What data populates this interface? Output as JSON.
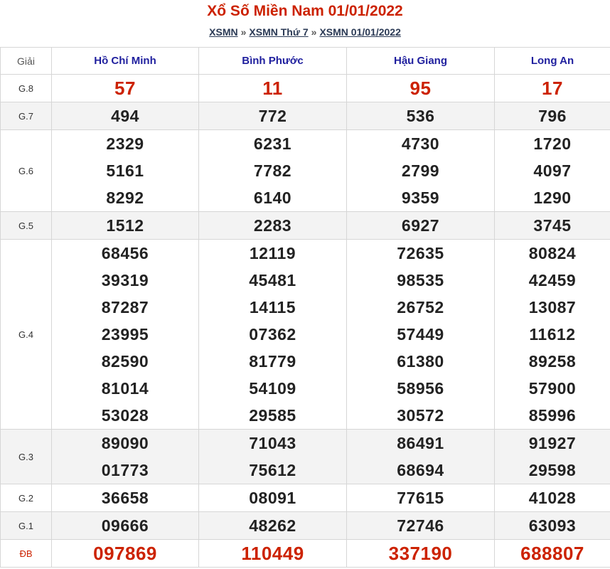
{
  "title": "Xổ Số Miền Nam 01/01/2022",
  "breadcrumb": [
    "XSMN",
    "XSMN Thứ 7",
    "XSMN 01/01/2022"
  ],
  "breadcrumb_sep": "»",
  "table": {
    "label_header": "Giải",
    "provinces": [
      "Hồ Chí Minh",
      "Bình Phước",
      "Hậu Giang",
      "Long An"
    ],
    "rows": [
      {
        "label": "G.8",
        "shade": false,
        "red": true,
        "values": [
          [
            "57"
          ],
          [
            "11"
          ],
          [
            "95"
          ],
          [
            "17"
          ]
        ]
      },
      {
        "label": "G.7",
        "shade": true,
        "red": false,
        "values": [
          [
            "494"
          ],
          [
            "772"
          ],
          [
            "536"
          ],
          [
            "796"
          ]
        ]
      },
      {
        "label": "G.6",
        "shade": false,
        "red": false,
        "values": [
          [
            "2329",
            "5161",
            "8292"
          ],
          [
            "6231",
            "7782",
            "6140"
          ],
          [
            "4730",
            "2799",
            "9359"
          ],
          [
            "1720",
            "4097",
            "1290"
          ]
        ]
      },
      {
        "label": "G.5",
        "shade": true,
        "red": false,
        "values": [
          [
            "1512"
          ],
          [
            "2283"
          ],
          [
            "6927"
          ],
          [
            "3745"
          ]
        ]
      },
      {
        "label": "G.4",
        "shade": false,
        "red": false,
        "values": [
          [
            "68456",
            "39319",
            "87287",
            "23995",
            "82590",
            "81014",
            "53028"
          ],
          [
            "12119",
            "45481",
            "14115",
            "07362",
            "81779",
            "54109",
            "29585"
          ],
          [
            "72635",
            "98535",
            "26752",
            "57449",
            "61380",
            "58956",
            "30572"
          ],
          [
            "80824",
            "42459",
            "13087",
            "11612",
            "89258",
            "57900",
            "85996"
          ]
        ]
      },
      {
        "label": "G.3",
        "shade": true,
        "red": false,
        "values": [
          [
            "89090",
            "01773"
          ],
          [
            "71043",
            "75612"
          ],
          [
            "86491",
            "68694"
          ],
          [
            "91927",
            "29598"
          ]
        ]
      },
      {
        "label": "G.2",
        "shade": false,
        "red": false,
        "values": [
          [
            "36658"
          ],
          [
            "08091"
          ],
          [
            "77615"
          ],
          [
            "41028"
          ]
        ]
      },
      {
        "label": "G.1",
        "shade": true,
        "red": false,
        "values": [
          [
            "09666"
          ],
          [
            "48262"
          ],
          [
            "72746"
          ],
          [
            "63093"
          ]
        ]
      },
      {
        "label": "ĐB",
        "shade": false,
        "red": true,
        "values": [
          [
            "097869"
          ],
          [
            "110449"
          ],
          [
            "337190"
          ],
          [
            "688807"
          ]
        ]
      }
    ]
  },
  "colors": {
    "accent_red": "#cc2200",
    "header_blue": "#1f1f9e",
    "link_navy": "#2b3a55",
    "shade": "#f3f3f3"
  }
}
